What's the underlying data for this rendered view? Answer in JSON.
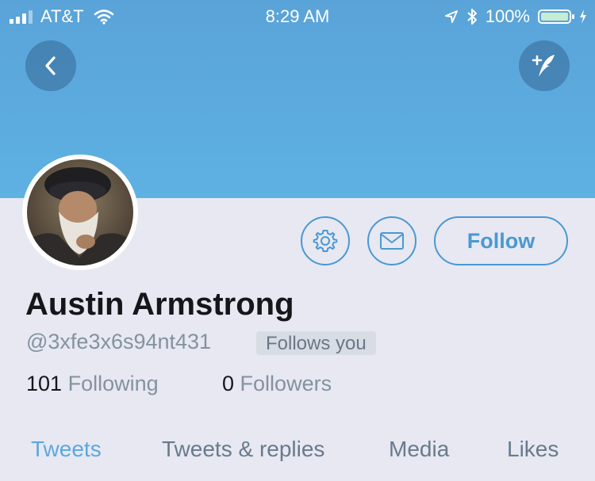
{
  "status_bar": {
    "carrier": "AT&T",
    "time": "8:29 AM",
    "battery_percent": "100%",
    "battery_level": 1.0,
    "icons": [
      "signal-icon",
      "wifi-icon",
      "location-icon",
      "bluetooth-icon",
      "battery-icon",
      "charging-icon"
    ]
  },
  "header": {
    "back_icon": "chevron-left-icon",
    "compose_icon": "compose-tweet-icon"
  },
  "profile": {
    "name": "Austin Armstrong",
    "handle": "@3xfe3x6s94nt431",
    "follows_you": "Follows you",
    "following_count": "101",
    "following_label": "Following",
    "followers_count": "0",
    "followers_label": "Followers"
  },
  "actions": {
    "settings_icon": "gear-icon",
    "message_icon": "envelope-icon",
    "follow_label": "Follow"
  },
  "tabs": [
    {
      "label": "Tweets",
      "active": true
    },
    {
      "label": "Tweets & replies",
      "active": false
    },
    {
      "label": "Media",
      "active": false
    },
    {
      "label": "Likes",
      "active": false
    }
  ],
  "colors": {
    "accent": "#4a98d2",
    "header_blue": "#5eb1e3",
    "background": "#e7e8f1",
    "active_tab": "#5ba8df"
  }
}
